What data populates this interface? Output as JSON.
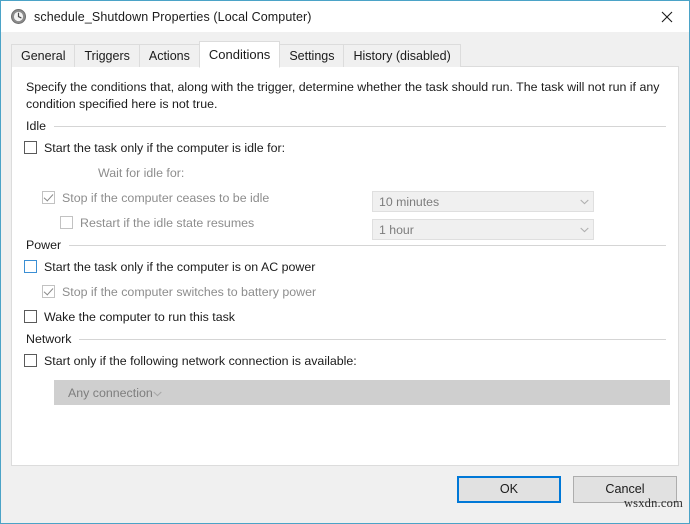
{
  "window": {
    "title": "schedule_Shutdown Properties (Local Computer)",
    "icon": "clock-task-icon",
    "close_label": "✕",
    "accent_color": "#0078d7",
    "border_color": "#4ba3c7"
  },
  "tabs": [
    {
      "label": "General",
      "active": false
    },
    {
      "label": "Triggers",
      "active": false
    },
    {
      "label": "Actions",
      "active": false
    },
    {
      "label": "Conditions",
      "active": true
    },
    {
      "label": "Settings",
      "active": false
    },
    {
      "label": "History (disabled)",
      "active": false
    }
  ],
  "description": "Specify the conditions that, along with the trigger, determine whether the task should run.  The task will not run  if any condition specified here is not true.",
  "groups": {
    "idle": {
      "label": "Idle",
      "start_if_idle": {
        "label": "Start the task only if the computer is idle for:",
        "checked": false,
        "disabled": false
      },
      "idle_duration": {
        "value": "10 minutes",
        "disabled": true
      },
      "wait_for_idle_label": "Wait for idle for:",
      "wait_duration": {
        "value": "1 hour",
        "disabled": true
      },
      "stop_if_ceases_idle": {
        "label": "Stop if the computer ceases to be idle",
        "checked": true,
        "disabled": true
      },
      "restart_if_idle_resumes": {
        "label": "Restart if the idle state resumes",
        "checked": false,
        "disabled": true
      }
    },
    "power": {
      "label": "Power",
      "start_if_ac_power": {
        "label": "Start the task only if the computer is on AC power",
        "checked": false,
        "disabled": false,
        "focused": true
      },
      "stop_if_battery": {
        "label": "Stop if the computer switches to battery power",
        "checked": true,
        "disabled": true
      },
      "wake_computer": {
        "label": "Wake the computer to run this task",
        "checked": false,
        "disabled": false
      }
    },
    "network": {
      "label": "Network",
      "start_if_network": {
        "label": "Start only if the following network connection is available:",
        "checked": false,
        "disabled": false
      },
      "connection": {
        "value": "Any connection",
        "disabled": true
      }
    }
  },
  "footer": {
    "ok_label": "OK",
    "cancel_label": "Cancel"
  },
  "watermark": "wsxdn.com"
}
